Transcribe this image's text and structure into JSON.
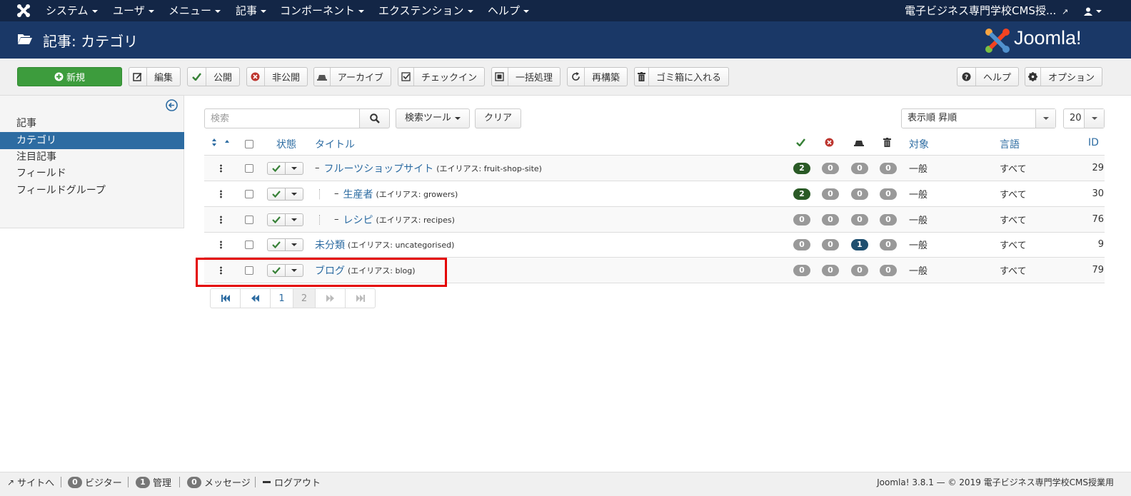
{
  "topnav": {
    "menus": [
      "システム",
      "ユーザ",
      "メニュー",
      "記事",
      "コンポーネント",
      "エクステンション",
      "ヘルプ"
    ],
    "site_name": "電子ビジネス専門学校CMS授..."
  },
  "header": {
    "title": "記事: カテゴリ",
    "brand": "Joomla!"
  },
  "toolbar": {
    "new": "新規",
    "edit": "編集",
    "publish": "公開",
    "unpublish": "非公開",
    "archive": "アーカイブ",
    "checkin": "チェックイン",
    "batch": "一括処理",
    "rebuild": "再構築",
    "trash": "ゴミ箱に入れる",
    "help": "ヘルプ",
    "options": "オプション"
  },
  "sidebar": {
    "items": [
      {
        "label": "記事",
        "active": false
      },
      {
        "label": "カテゴリ",
        "active": true
      },
      {
        "label": "注目記事",
        "active": false
      },
      {
        "label": "フィールド",
        "active": false
      },
      {
        "label": "フィールドグループ",
        "active": false
      }
    ]
  },
  "filters": {
    "search_placeholder": "検索",
    "search_tools": "検索ツール",
    "clear": "クリア",
    "ordering": "表示順 昇順",
    "limit": "20"
  },
  "table": {
    "headers": {
      "status": "状態",
      "title": "タイトル",
      "access": "対象",
      "language": "言語",
      "id": "ID"
    },
    "rows": [
      {
        "title": "フルーツショップサイト",
        "alias": "(エイリアス: fruit-shop-site)",
        "published": "2",
        "unpublished": "0",
        "archived": "0",
        "trashed": "0",
        "access": "一般",
        "language": "すべて",
        "id": "29",
        "level": 1
      },
      {
        "title": "生産者",
        "alias": "(エイリアス: growers)",
        "published": "2",
        "unpublished": "0",
        "archived": "0",
        "trashed": "0",
        "access": "一般",
        "language": "すべて",
        "id": "30",
        "level": 2
      },
      {
        "title": "レシピ",
        "alias": "(エイリアス: recipes)",
        "published": "0",
        "unpublished": "0",
        "archived": "0",
        "trashed": "0",
        "access": "一般",
        "language": "すべて",
        "id": "76",
        "level": 2
      },
      {
        "title": "未分類",
        "alias": "(エイリアス: uncategorised)",
        "published": "0",
        "unpublished": "0",
        "archived": "1",
        "trashed": "0",
        "access": "一般",
        "language": "すべて",
        "id": "9",
        "level": 0
      },
      {
        "title": "ブログ",
        "alias": "(エイリアス: blog)",
        "published": "0",
        "unpublished": "0",
        "archived": "0",
        "trashed": "0",
        "access": "一般",
        "language": "すべて",
        "id": "79",
        "level": 0
      }
    ]
  },
  "pagination": {
    "pages": [
      "1",
      "2"
    ],
    "current": "2"
  },
  "footer": {
    "site": "サイトへ",
    "visitors_count": "0",
    "visitors": "ビジター",
    "admins_count": "1",
    "admins": "管理",
    "messages_count": "0",
    "messages": "メッセージ",
    "logout": "ログアウト",
    "copyright": "Joomla! 3.8.1 — © 2019 電子ビジネス専門学校CMS授業用"
  },
  "colors": {
    "topnav": "#132646",
    "header": "#1a3867",
    "link": "#2d6ca2",
    "new_button": "#3d9c3d",
    "highlight": "#e40000"
  }
}
